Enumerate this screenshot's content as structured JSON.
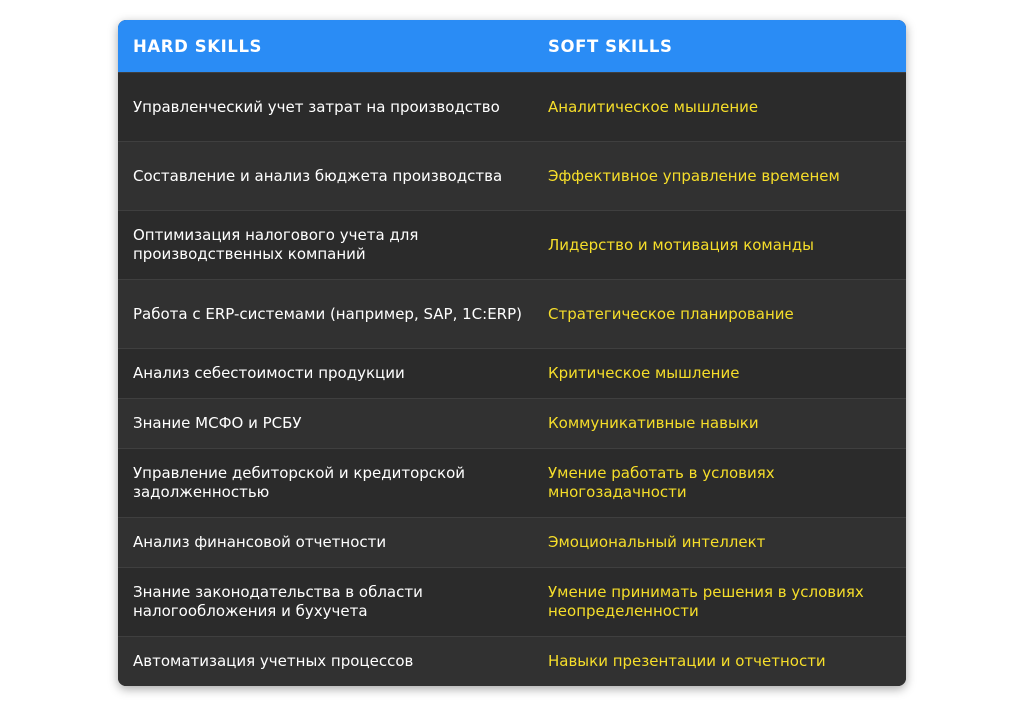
{
  "table": {
    "headers": {
      "hard": "HARD SKILLS",
      "soft": "SOFT SKILLS"
    },
    "colors": {
      "header_bg": "#2a8cf5",
      "body_bg": "#2e2e2e",
      "hard_text": "#ffffff",
      "soft_text": "#f6de2a"
    },
    "rows": [
      {
        "hard": "Управленческий учет затрат на производство",
        "soft": "Аналитическое мышление"
      },
      {
        "hard": "Составление и анализ бюджета производства",
        "soft": "Эффективное управление временем"
      },
      {
        "hard": "Оптимизация налогового учета для производственных компаний",
        "soft": "Лидерство и мотивация команды"
      },
      {
        "hard": "Работа с ERP-системами (например, SAP, 1C:ERP)",
        "soft": "Стратегическое планирование"
      },
      {
        "hard": "Анализ себестоимости продукции",
        "soft": "Критическое мышление"
      },
      {
        "hard": "Знание МСФО и РСБУ",
        "soft": "Коммуникативные навыки"
      },
      {
        "hard": "Управление дебиторской и кредиторской задолженностью",
        "soft": "Умение работать в условиях многозадачности"
      },
      {
        "hard": "Анализ финансовой отчетности",
        "soft": "Эмоциональный интеллект"
      },
      {
        "hard": "Знание законодательства в области налогообложения и бухучета",
        "soft": "Умение принимать решения в условиях неопределенности"
      },
      {
        "hard": "Автоматизация учетных процессов",
        "soft": "Навыки презентации и отчетности"
      }
    ]
  }
}
